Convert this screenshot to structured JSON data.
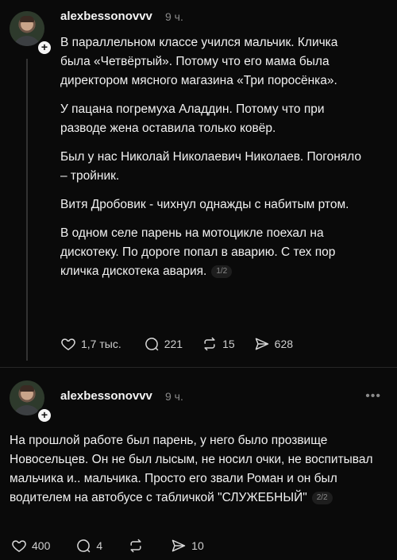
{
  "posts": [
    {
      "username": "alexbessonovvv",
      "time": "9 ч.",
      "paragraphs": [
        "В параллельном классе учился мальчик. Кличка была «Четвёртый». Потому что его мама была директором мясного магазина «Три поросёнка».",
        "У пацана погремуха Аладдин. Потому что при разводе жена оставила только ковёр.",
        "Был у нас Николай Николаевич Николаев. Погоняло – тройник.",
        "Витя Дробовик - чихнул однажды с набитым ртом.",
        "В одном селе парень на мотоцикле поехал на дискотеку. По дороге попал в аварию. С тех пор кличка дискотека авария."
      ],
      "page_badge": "1/2",
      "likes": "1,7 тыс.",
      "comments": "221",
      "reposts": "15",
      "shares": "628"
    },
    {
      "username": "alexbessonovvv",
      "time": "9 ч.",
      "more": "•••",
      "paragraphs": [
        "На прошлой работе был парень, у него было прозвище Новосельцев. Он не был лысым, не носил очки, не воспитывал мальчика и.. мальчика. Просто его звали Роман и он был водителем на автобусе с табличкой \"СЛУЖЕБНЫЙ\""
      ],
      "page_badge": "2/2",
      "likes": "400",
      "comments": "4",
      "reposts": "",
      "shares": "10"
    }
  ]
}
